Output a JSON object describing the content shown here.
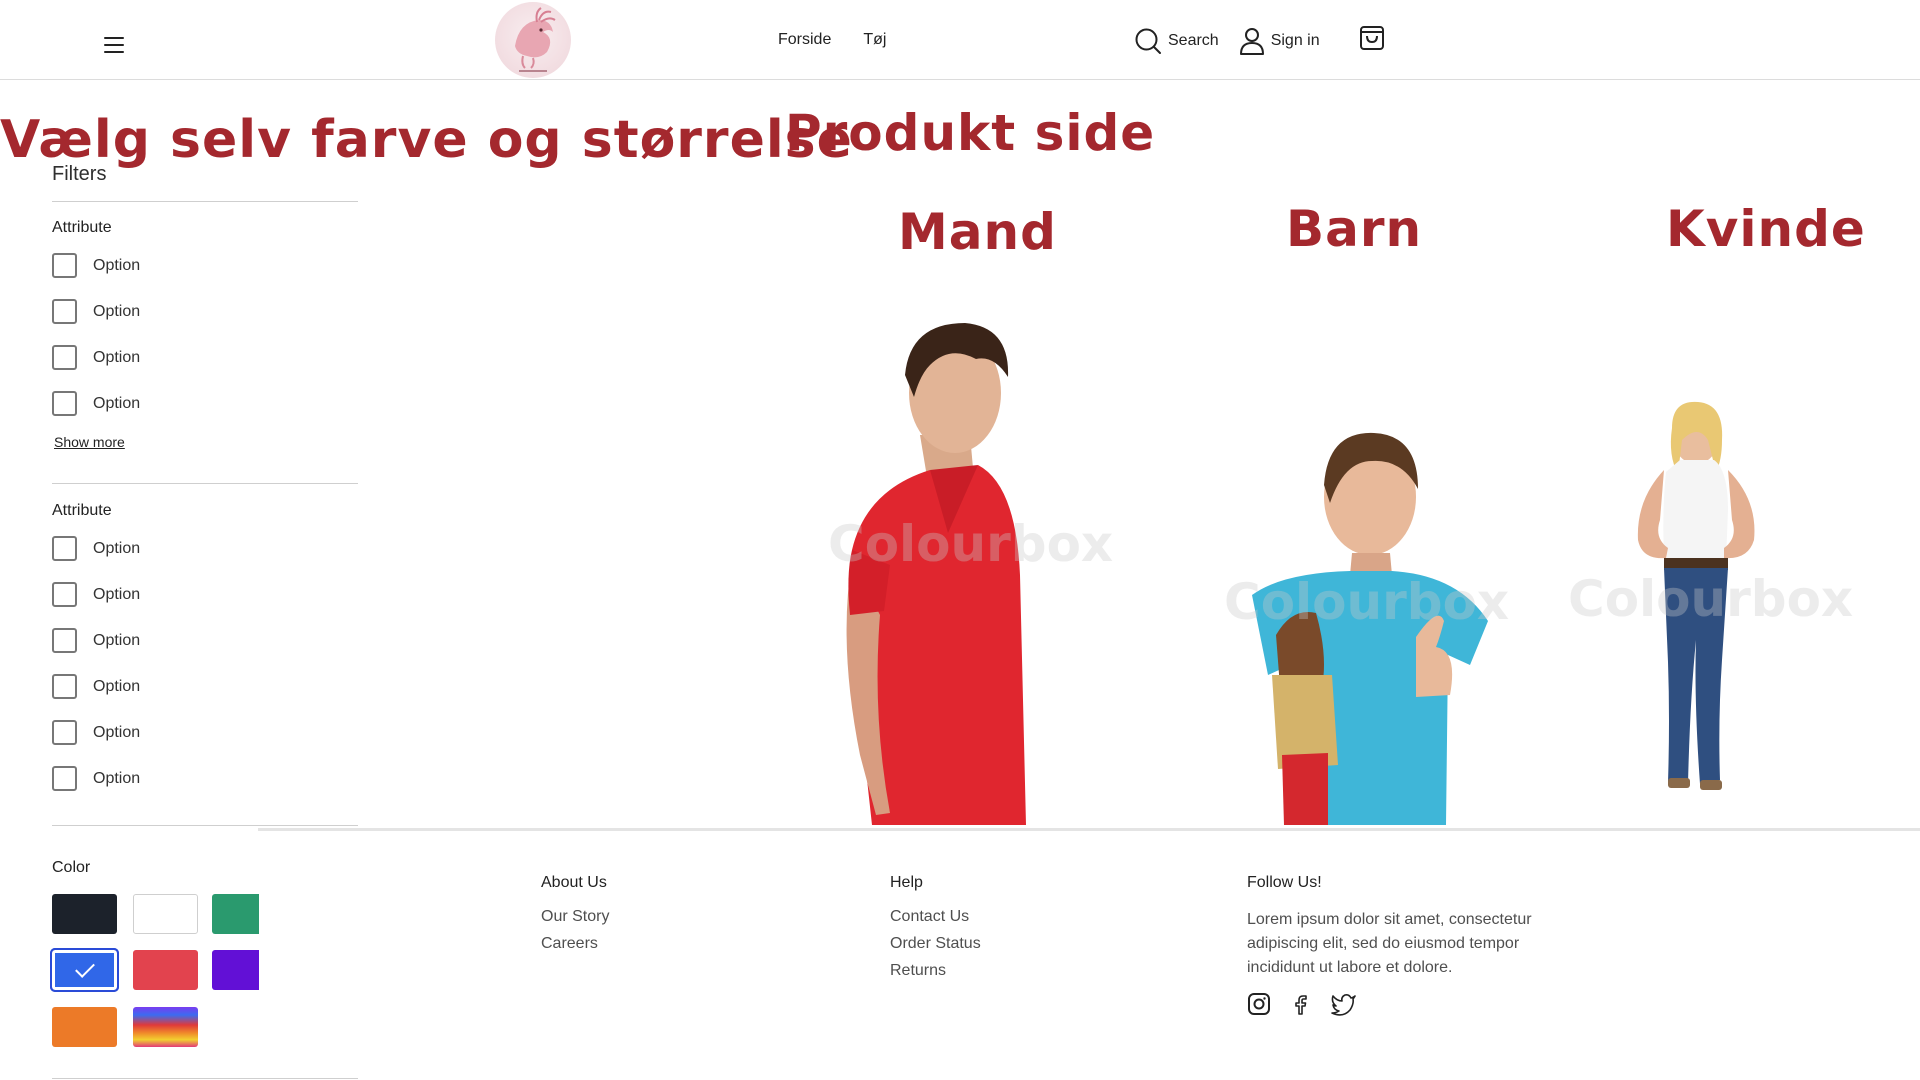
{
  "header": {
    "logo_alt": "logo",
    "nav": [
      "Forside",
      "Tøj"
    ],
    "search_label": "Search",
    "signin_label": "Sign in"
  },
  "headings": {
    "main": "Vælg selv farve og størrelse",
    "product_page": "Produkt side",
    "categories": [
      "Mand",
      "Barn",
      "Kvinde"
    ]
  },
  "filters": {
    "title": "Filters",
    "groups": [
      {
        "title": "Attribute",
        "options": [
          "Option",
          "Option",
          "Option",
          "Option"
        ],
        "show_more": "Show more"
      },
      {
        "title": "Attribute",
        "options": [
          "Option",
          "Option",
          "Option",
          "Option",
          "Option",
          "Option"
        ]
      }
    ],
    "color": {
      "title": "Color",
      "swatches": [
        {
          "name": "black",
          "color": "#1c222b",
          "selected": false
        },
        {
          "name": "white",
          "color": "#ffffff",
          "selected": false
        },
        {
          "name": "green",
          "color": "#2a9a6e",
          "selected": false
        },
        {
          "name": "blue",
          "color": "#3067e8",
          "selected": true
        },
        {
          "name": "red",
          "color": "#e2434e",
          "selected": false
        },
        {
          "name": "purple",
          "color": "#6210d6",
          "selected": false
        },
        {
          "name": "orange",
          "color": "#ec7a28",
          "selected": false
        },
        {
          "name": "rainbow",
          "color": "gradient",
          "selected": false
        }
      ]
    }
  },
  "products": {
    "watermark": "Colourbox"
  },
  "footer": {
    "about": {
      "title": "About Us",
      "links": [
        "Our Story",
        "Careers"
      ]
    },
    "help": {
      "title": "Help",
      "links": [
        "Contact Us",
        "Order Status",
        "Returns"
      ]
    },
    "follow": {
      "title": "Follow Us!",
      "text": "Lorem ipsum dolor sit amet, consectetur adipiscing elit, sed do eiusmod tempor incididunt ut labore et dolore.",
      "icons": [
        "instagram-icon",
        "facebook-icon",
        "twitter-icon"
      ]
    }
  },
  "colors": {
    "accent": "#a4282e",
    "selected_outline": "#2a4bd7"
  }
}
